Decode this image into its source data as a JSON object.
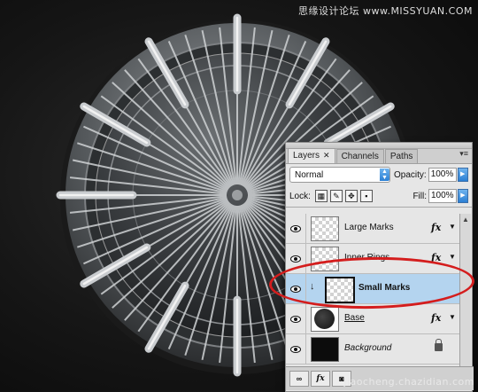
{
  "watermark_top": "思缘设计论坛 www.MISSYUAN.COM",
  "watermark_bottom": "jiaocheng.chazidian.com",
  "panel": {
    "tabs": [
      {
        "label": "Layers",
        "close": "✕"
      },
      {
        "label": "Channels"
      },
      {
        "label": "Paths"
      }
    ],
    "blend_mode": "Normal",
    "opacity_label": "Opacity:",
    "opacity_value": "100%",
    "lock_label": "Lock:",
    "fill_label": "Fill:",
    "fill_value": "100%",
    "layers": [
      {
        "name": "Large Marks",
        "fx": "fx"
      },
      {
        "name": "Inner Rings",
        "fx": "fx"
      },
      {
        "name": "Small Marks"
      },
      {
        "name": "Base",
        "fx": "fx"
      },
      {
        "name": "Background"
      }
    ],
    "bottom_buttons": [
      "∞",
      "fx",
      "◙"
    ]
  },
  "icons": [
    "eye-icon",
    "lock-icon",
    "fx-icon",
    "link-icon",
    "mask-icon"
  ],
  "colors": {
    "highlight": "#d41d1d",
    "selected_row": "#b4d4ef"
  }
}
